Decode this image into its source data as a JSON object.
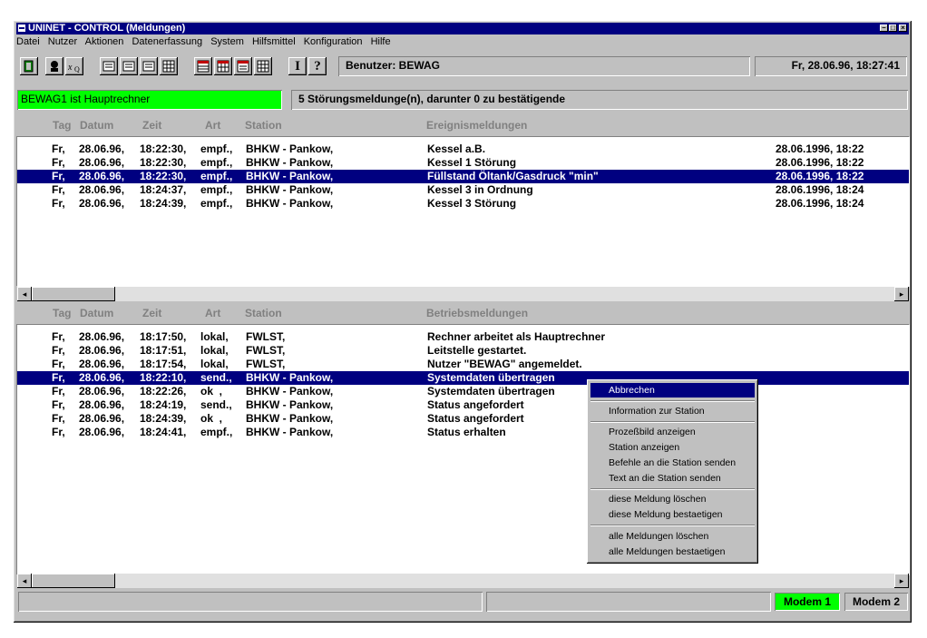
{
  "window": {
    "title": "UNINET - CONTROL (Meldungen)"
  },
  "menu": [
    "Datei",
    "Nutzer",
    "Aktionen",
    "Datenerfassung",
    "System",
    "Hilfsmittel",
    "Konfiguration",
    "Hilfe"
  ],
  "toolbar": {
    "icons": [
      "exit-icon",
      "user-icon",
      "formula-icon",
      "view-1-icon",
      "view-2-icon",
      "view-3-icon",
      "table-icon",
      "report-1-icon",
      "report-2-icon",
      "report-3-icon",
      "report-4-icon",
      "info-icon",
      "help-icon"
    ],
    "info_glyph": "I",
    "help_glyph": "?",
    "user_label": "Benutzer: BEWAG",
    "datetime": "Fr, 28.06.96,  18:27:41"
  },
  "status": {
    "host": "BEWAG1 ist Hauptrechner",
    "host_color": "#00ff00",
    "messages": "5 Störungsmeldunge(n), darunter 0 zu bestätigende"
  },
  "columns": {
    "tag": "Tag",
    "datum": "Datum",
    "zeit": "Zeit",
    "art": "Art",
    "station": "Station"
  },
  "events": {
    "title": "Ereignismeldungen",
    "rows": [
      {
        "tag": "Fr,",
        "datum": "28.06.96,",
        "zeit": "18:22:30,",
        "art": "empf.,",
        "station": "BHKW - Pankow,",
        "msg": "Kessel a.B.",
        "ts": "28.06.1996, 18:22",
        "selected": false
      },
      {
        "tag": "Fr,",
        "datum": "28.06.96,",
        "zeit": "18:22:30,",
        "art": "empf.,",
        "station": "BHKW - Pankow,",
        "msg": "Kessel 1 Störung",
        "ts": "28.06.1996, 18:22",
        "selected": false
      },
      {
        "tag": "Fr,",
        "datum": "28.06.96,",
        "zeit": "18:22:30,",
        "art": "empf.,",
        "station": "BHKW - Pankow,",
        "msg": "Füllstand Öltank/Gasdruck \"min\"",
        "ts": "28.06.1996, 18:22",
        "selected": true
      },
      {
        "tag": "Fr,",
        "datum": "28.06.96,",
        "zeit": "18:24:37,",
        "art": "empf.,",
        "station": "BHKW - Pankow,",
        "msg": "Kessel 3 in Ordnung",
        "ts": "28.06.1996, 18:24",
        "selected": false
      },
      {
        "tag": "Fr,",
        "datum": "28.06.96,",
        "zeit": "18:24:39,",
        "art": "empf.,",
        "station": "BHKW - Pankow,",
        "msg": "Kessel 3 Störung",
        "ts": "28.06.1996, 18:24",
        "selected": false
      }
    ]
  },
  "operations": {
    "title": "Betriebsmeldungen",
    "rows": [
      {
        "tag": "Fr,",
        "datum": "28.06.96,",
        "zeit": "18:17:50,",
        "art": "lokal,",
        "station": "FWLST,",
        "msg": "Rechner arbeitet als Hauptrechner",
        "selected": false
      },
      {
        "tag": "Fr,",
        "datum": "28.06.96,",
        "zeit": "18:17:51,",
        "art": "lokal,",
        "station": "FWLST,",
        "msg": "Leitstelle gestartet.",
        "selected": false
      },
      {
        "tag": "Fr,",
        "datum": "28.06.96,",
        "zeit": "18:17:54,",
        "art": "lokal,",
        "station": "FWLST,",
        "msg": "Nutzer \"BEWAG\" angemeldet.",
        "selected": false
      },
      {
        "tag": "Fr,",
        "datum": "28.06.96,",
        "zeit": "18:22:10,",
        "art": "send.,",
        "station": "BHKW - Pankow,",
        "msg": "Systemdaten übertragen",
        "selected": true
      },
      {
        "tag": "Fr,",
        "datum": "28.06.96,",
        "zeit": "18:22:26,",
        "art": "ok  ,",
        "station": "BHKW - Pankow,",
        "msg": "Systemdaten übertragen",
        "selected": false
      },
      {
        "tag": "Fr,",
        "datum": "28.06.96,",
        "zeit": "18:24:19,",
        "art": "send.,",
        "station": "BHKW - Pankow,",
        "msg": "Status angefordert",
        "selected": false
      },
      {
        "tag": "Fr,",
        "datum": "28.06.96,",
        "zeit": "18:24:39,",
        "art": "ok  ,",
        "station": "BHKW - Pankow,",
        "msg": "Status angefordert",
        "selected": false
      },
      {
        "tag": "Fr,",
        "datum": "28.06.96,",
        "zeit": "18:24:41,",
        "art": "empf.,",
        "station": "BHKW - Pankow,",
        "msg": "Status erhalten",
        "selected": false
      }
    ]
  },
  "context_menu": {
    "items": [
      {
        "label": "Abbrechen",
        "selected": true
      },
      {
        "label": "Information zur Station"
      },
      {
        "label": "Prozeßbild anzeigen"
      },
      {
        "label": "Station anzeigen"
      },
      {
        "label": "Befehle an die Station senden"
      },
      {
        "label": "Text an die Station senden"
      },
      {
        "label": "diese Meldung löschen"
      },
      {
        "label": "diese Meldung bestaetigen"
      },
      {
        "label": "alle Meldungen löschen"
      },
      {
        "label": "alle Meldungen bestaetigen"
      }
    ]
  },
  "statusbar": {
    "modem1": "Modem 1",
    "modem1_color": "#00ff00",
    "modem2": "Modem 2"
  }
}
